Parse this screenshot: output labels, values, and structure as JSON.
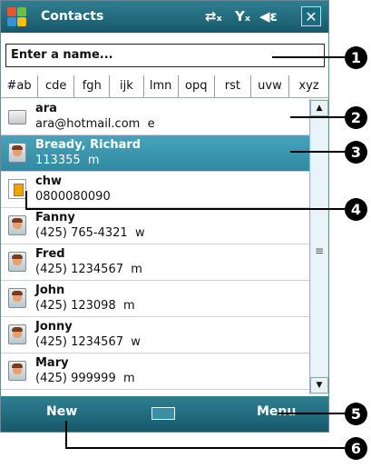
{
  "window": {
    "title": "Contacts"
  },
  "search": {
    "value": "Enter a name..."
  },
  "alphabet_tabs": [
    "#ab",
    "cde",
    "fgh",
    "ijk",
    "lmn",
    "opq",
    "rst",
    "uvw",
    "xyz"
  ],
  "contacts": [
    {
      "name": "ara",
      "detail": "ara@hotmail.com",
      "type": "e",
      "icon": "folder-icon"
    },
    {
      "name": "Bready, Richard",
      "detail": "113355",
      "type": "m",
      "icon": "contact-card-icon",
      "selected": true
    },
    {
      "name": "chw",
      "detail": "0800080090",
      "type": "",
      "icon": "sim-card-icon"
    },
    {
      "name": "Fanny",
      "detail": "(425) 765-4321",
      "type": "w",
      "icon": "contact-card-icon"
    },
    {
      "name": "Fred",
      "detail": "(425) 1234567",
      "type": "m",
      "icon": "contact-card-icon"
    },
    {
      "name": "John",
      "detail": "(425) 123098",
      "type": "m",
      "icon": "contact-card-icon"
    },
    {
      "name": "Jonny",
      "detail": "(425) 1234567",
      "type": "w",
      "icon": "contact-card-icon"
    },
    {
      "name": "Mary",
      "detail": "(425) 999999",
      "type": "m",
      "icon": "contact-card-icon"
    }
  ],
  "softkeys": {
    "left": "New",
    "right": "Menu"
  },
  "callouts": [
    "1",
    "2",
    "3",
    "4",
    "5",
    "6"
  ],
  "colors": {
    "bar": "#1f6f82",
    "selected": "#3b97ae"
  }
}
